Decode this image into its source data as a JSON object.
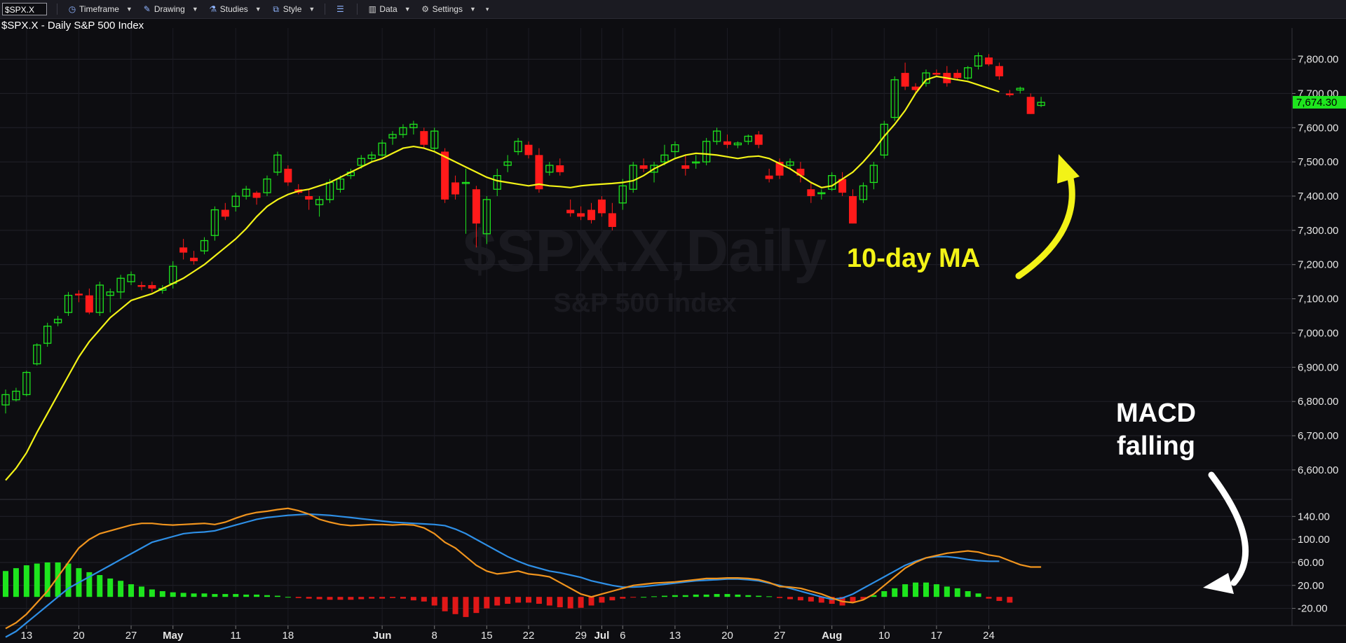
{
  "toolbar": {
    "symbol": "$SPX.X",
    "items": [
      {
        "label": "Timeframe",
        "icon": "clock-icon"
      },
      {
        "label": "Drawing",
        "icon": "pencil-icon"
      },
      {
        "label": "Studies",
        "icon": "flask-icon"
      },
      {
        "label": "Style",
        "icon": "chart-style-icon"
      },
      {
        "label": "Data",
        "icon": "bar-chart-icon"
      },
      {
        "label": "Settings",
        "icon": "gear-icon"
      }
    ]
  },
  "header": {
    "title": "$SPX.X - Daily  S&P 500 Index"
  },
  "watermark": {
    "symbol": "$SPX.X,Daily",
    "name": "S&P 500 Index"
  },
  "annotations": {
    "ma": "10-day MA",
    "macd_line1": "MACD",
    "macd_line2": "falling"
  },
  "colors": {
    "up": "#1ee51e",
    "down": "#ff1a1a",
    "ma": "#f3f317",
    "macd": "#2e8fe6",
    "signal": "#f0941e",
    "hist_pos": "#1ee51e",
    "hist_neg": "#e01818",
    "last_price_bg": "#1ee51e"
  },
  "chart_data": [
    {
      "type": "candlestick",
      "title": "$SPX.X - Daily",
      "subtitle": "S&P 500 Index",
      "last_price": "7,674.30",
      "y_ticks": [
        "6,600.00",
        "6,700.00",
        "6,800.00",
        "6,900.00",
        "7,000.00",
        "7,100.00",
        "7,200.00",
        "7,300.00",
        "7,400.00",
        "7,500.00",
        "7,600.00",
        "7,700.00",
        "7,800.00"
      ],
      "ylim": [
        6520,
        7840
      ],
      "x_ticks": [
        {
          "label": "13",
          "i": 2,
          "bold": false
        },
        {
          "label": "20",
          "i": 7,
          "bold": false
        },
        {
          "label": "27",
          "i": 12,
          "bold": false
        },
        {
          "label": "May",
          "i": 16,
          "bold": true
        },
        {
          "label": "11",
          "i": 22,
          "bold": false
        },
        {
          "label": "18",
          "i": 27,
          "bold": false
        },
        {
          "label": "Jun",
          "i": 36,
          "bold": true
        },
        {
          "label": "8",
          "i": 41,
          "bold": false
        },
        {
          "label": "15",
          "i": 46,
          "bold": false
        },
        {
          "label": "22",
          "i": 50,
          "bold": false
        },
        {
          "label": "29",
          "i": 55,
          "bold": false
        },
        {
          "label": "Jul",
          "i": 57,
          "bold": true
        },
        {
          "label": "6",
          "i": 59,
          "bold": false
        },
        {
          "label": "13",
          "i": 64,
          "bold": false
        },
        {
          "label": "20",
          "i": 69,
          "bold": false
        },
        {
          "label": "27",
          "i": 74,
          "bold": false
        },
        {
          "label": "Aug",
          "i": 79,
          "bold": true
        },
        {
          "label": "10",
          "i": 84,
          "bold": false
        },
        {
          "label": "17",
          "i": 89,
          "bold": false
        },
        {
          "label": "24",
          "i": 94,
          "bold": false
        }
      ],
      "ohlc": [
        [
          6790,
          6835,
          6765,
          6820
        ],
        [
          6805,
          6840,
          6800,
          6830
        ],
        [
          6820,
          6890,
          6815,
          6885
        ],
        [
          6910,
          6970,
          6905,
          6965
        ],
        [
          6970,
          7030,
          6960,
          7020
        ],
        [
          7030,
          7050,
          7020,
          7040
        ],
        [
          7060,
          7120,
          7050,
          7110
        ],
        [
          7115,
          7125,
          7090,
          7110
        ],
        [
          7110,
          7130,
          7055,
          7060
        ],
        [
          7060,
          7150,
          7050,
          7140
        ],
        [
          7110,
          7130,
          7060,
          7120
        ],
        [
          7120,
          7170,
          7100,
          7160
        ],
        [
          7150,
          7180,
          7140,
          7170
        ],
        [
          7140,
          7150,
          7125,
          7135
        ],
        [
          7140,
          7150,
          7120,
          7130
        ],
        [
          7125,
          7140,
          7115,
          7130
        ],
        [
          7145,
          7210,
          7130,
          7195
        ],
        [
          7250,
          7275,
          7215,
          7235
        ],
        [
          7220,
          7240,
          7200,
          7210
        ],
        [
          7240,
          7280,
          7230,
          7270
        ],
        [
          7285,
          7370,
          7270,
          7360
        ],
        [
          7360,
          7380,
          7330,
          7340
        ],
        [
          7370,
          7410,
          7355,
          7400
        ],
        [
          7400,
          7430,
          7390,
          7420
        ],
        [
          7410,
          7415,
          7375,
          7395
        ],
        [
          7410,
          7460,
          7400,
          7450
        ],
        [
          7470,
          7530,
          7460,
          7520
        ],
        [
          7480,
          7490,
          7430,
          7440
        ],
        [
          7420,
          7435,
          7405,
          7410
        ],
        [
          7400,
          7420,
          7360,
          7390
        ],
        [
          7375,
          7400,
          7340,
          7390
        ],
        [
          7390,
          7450,
          7380,
          7440
        ],
        [
          7420,
          7460,
          7410,
          7450
        ],
        [
          7460,
          7480,
          7450,
          7470
        ],
        [
          7490,
          7520,
          7480,
          7510
        ],
        [
          7510,
          7530,
          7500,
          7520
        ],
        [
          7520,
          7565,
          7515,
          7555
        ],
        [
          7570,
          7590,
          7550,
          7580
        ],
        [
          7580,
          7610,
          7570,
          7600
        ],
        [
          7600,
          7620,
          7580,
          7610
        ],
        [
          7590,
          7600,
          7540,
          7550
        ],
        [
          7540,
          7600,
          7530,
          7590
        ],
        [
          7530,
          7540,
          7380,
          7390
        ],
        [
          7440,
          7460,
          7390,
          7405
        ],
        [
          7440,
          7480,
          7290,
          7440
        ],
        [
          7420,
          7430,
          7250,
          7320
        ],
        [
          7290,
          7400,
          7260,
          7390
        ],
        [
          7420,
          7480,
          7400,
          7460
        ],
        [
          7490,
          7520,
          7470,
          7500
        ],
        [
          7530,
          7570,
          7520,
          7560
        ],
        [
          7550,
          7560,
          7510,
          7520
        ],
        [
          7520,
          7540,
          7410,
          7420
        ],
        [
          7470,
          7500,
          7460,
          7490
        ],
        [
          7490,
          7510,
          7460,
          7470
        ],
        [
          7360,
          7390,
          7340,
          7350
        ],
        [
          7350,
          7370,
          7330,
          7340
        ],
        [
          7360,
          7380,
          7320,
          7330
        ],
        [
          7390,
          7400,
          7340,
          7350
        ],
        [
          7350,
          7380,
          7300,
          7310
        ],
        [
          7380,
          7450,
          7360,
          7430
        ],
        [
          7420,
          7500,
          7410,
          7490
        ],
        [
          7490,
          7510,
          7470,
          7480
        ],
        [
          7470,
          7500,
          7440,
          7490
        ],
        [
          7500,
          7550,
          7490,
          7520
        ],
        [
          7530,
          7560,
          7510,
          7550
        ],
        [
          7490,
          7520,
          7460,
          7480
        ],
        [
          7500,
          7520,
          7480,
          7500
        ],
        [
          7500,
          7570,
          7490,
          7560
        ],
        [
          7560,
          7600,
          7550,
          7590
        ],
        [
          7560,
          7580,
          7540,
          7550
        ],
        [
          7550,
          7560,
          7540,
          7555
        ],
        [
          7560,
          7580,
          7550,
          7575
        ],
        [
          7580,
          7590,
          7540,
          7550
        ],
        [
          7460,
          7480,
          7440,
          7450
        ],
        [
          7500,
          7510,
          7450,
          7460
        ],
        [
          7490,
          7510,
          7480,
          7500
        ],
        [
          7480,
          7500,
          7440,
          7460
        ],
        [
          7420,
          7440,
          7380,
          7400
        ],
        [
          7410,
          7420,
          7390,
          7410
        ],
        [
          7420,
          7470,
          7415,
          7460
        ],
        [
          7450,
          7470,
          7400,
          7410
        ],
        [
          7400,
          7420,
          7320,
          7320
        ],
        [
          7390,
          7440,
          7380,
          7430
        ],
        [
          7440,
          7500,
          7420,
          7490
        ],
        [
          7520,
          7620,
          7510,
          7610
        ],
        [
          7630,
          7750,
          7620,
          7740
        ],
        [
          7760,
          7790,
          7710,
          7720
        ],
        [
          7720,
          7730,
          7700,
          7710
        ],
        [
          7730,
          7770,
          7720,
          7760
        ],
        [
          7760,
          7770,
          7750,
          7755
        ],
        [
          7760,
          7780,
          7720,
          7730
        ],
        [
          7760,
          7770,
          7740,
          7745
        ],
        [
          7745,
          7780,
          7740,
          7775
        ],
        [
          7780,
          7820,
          7770,
          7810
        ],
        [
          7805,
          7815,
          7780,
          7785
        ],
        [
          7780,
          7790,
          7740,
          7750
        ],
        [
          7700,
          7710,
          7690,
          7695
        ],
        [
          7710,
          7720,
          7700,
          7715
        ],
        [
          7690,
          7700,
          7640,
          7640
        ],
        [
          7665,
          7690,
          7660,
          7674
        ]
      ],
      "ma10": [
        6570,
        6605,
        6650,
        6710,
        6765,
        6820,
        6875,
        6930,
        6975,
        7010,
        7045,
        7070,
        7095,
        7105,
        7115,
        7130,
        7145,
        7160,
        7180,
        7200,
        7225,
        7250,
        7275,
        7305,
        7340,
        7370,
        7390,
        7405,
        7415,
        7420,
        7430,
        7440,
        7455,
        7470,
        7485,
        7500,
        7510,
        7525,
        7540,
        7545,
        7540,
        7530,
        7515,
        7500,
        7485,
        7470,
        7455,
        7445,
        7440,
        7435,
        7430,
        7435,
        7430,
        7428,
        7425,
        7430,
        7433,
        7435,
        7437,
        7440,
        7445,
        7460,
        7480,
        7495,
        7510,
        7520,
        7525,
        7523,
        7520,
        7515,
        7510,
        7515,
        7517,
        7510,
        7495,
        7480,
        7460,
        7440,
        7425,
        7430,
        7450,
        7470,
        7500,
        7535,
        7575,
        7610,
        7650,
        7700,
        7740,
        7750,
        7745,
        7740,
        7735,
        7725,
        7715,
        7705
      ]
    },
    {
      "type": "macd",
      "y_ticks": [
        "140.00",
        "100.00",
        "60.00",
        "20.00",
        "-20.00"
      ],
      "ylim": [
        -40,
        155
      ],
      "macd": [
        -70,
        -60,
        -45,
        -30,
        -15,
        0,
        15,
        25,
        35,
        45,
        55,
        65,
        75,
        85,
        95,
        100,
        105,
        110,
        112,
        113,
        115,
        120,
        125,
        130,
        135,
        138,
        140,
        142,
        143,
        144,
        143,
        142,
        140,
        138,
        136,
        134,
        132,
        130,
        129,
        128,
        127,
        126,
        124,
        118,
        110,
        100,
        90,
        80,
        70,
        62,
        55,
        50,
        45,
        42,
        38,
        34,
        28,
        24,
        20,
        17,
        17,
        18,
        20,
        22,
        24,
        26,
        28,
        29,
        30,
        31,
        31,
        30,
        28,
        24,
        20,
        15,
        10,
        5,
        0,
        -4,
        -2,
        5,
        15,
        25,
        35,
        45,
        55,
        62,
        68,
        70,
        70,
        68,
        65,
        63,
        62,
        62
      ],
      "signal": [
        -55,
        -45,
        -30,
        -10,
        10,
        35,
        60,
        85,
        100,
        110,
        115,
        120,
        125,
        128,
        128,
        126,
        125,
        126,
        127,
        128,
        126,
        130,
        137,
        143,
        147,
        149,
        152,
        154,
        150,
        144,
        135,
        130,
        126,
        124,
        125,
        126,
        126,
        125,
        126,
        125,
        120,
        110,
        95,
        85,
        70,
        55,
        45,
        40,
        42,
        45,
        40,
        38,
        35,
        25,
        15,
        5,
        0,
        5,
        10,
        15,
        20,
        22,
        24,
        25,
        26,
        28,
        30,
        32,
        32,
        33,
        33,
        32,
        30,
        25,
        18,
        17,
        15,
        10,
        5,
        -2,
        -8,
        -10,
        -5,
        5,
        20,
        35,
        50,
        60,
        68,
        72,
        76,
        78,
        80,
        78,
        73,
        70,
        63,
        56,
        52,
        52
      ],
      "histogram": [
        45,
        50,
        55,
        58,
        60,
        60,
        58,
        50,
        43,
        38,
        32,
        28,
        22,
        18,
        13,
        10,
        8,
        7,
        6,
        6,
        5,
        5,
        5,
        4,
        4,
        3,
        2,
        0,
        -2,
        -3,
        -4,
        -5,
        -5,
        -5,
        -4,
        -3,
        -3,
        -2,
        -3,
        -6,
        -8,
        -15,
        -25,
        -30,
        -35,
        -28,
        -20,
        -15,
        -12,
        -10,
        -10,
        -12,
        -15,
        -18,
        -20,
        -19,
        -15,
        -10,
        -6,
        -3,
        -1,
        0,
        1,
        2,
        3,
        3,
        4,
        4,
        5,
        5,
        4,
        3,
        2,
        1,
        -2,
        -4,
        -6,
        -8,
        -10,
        -12,
        -15,
        -10,
        -4,
        3,
        10,
        15,
        22,
        25,
        25,
        22,
        18,
        15,
        10,
        6,
        -3,
        -7,
        -10
      ]
    }
  ]
}
